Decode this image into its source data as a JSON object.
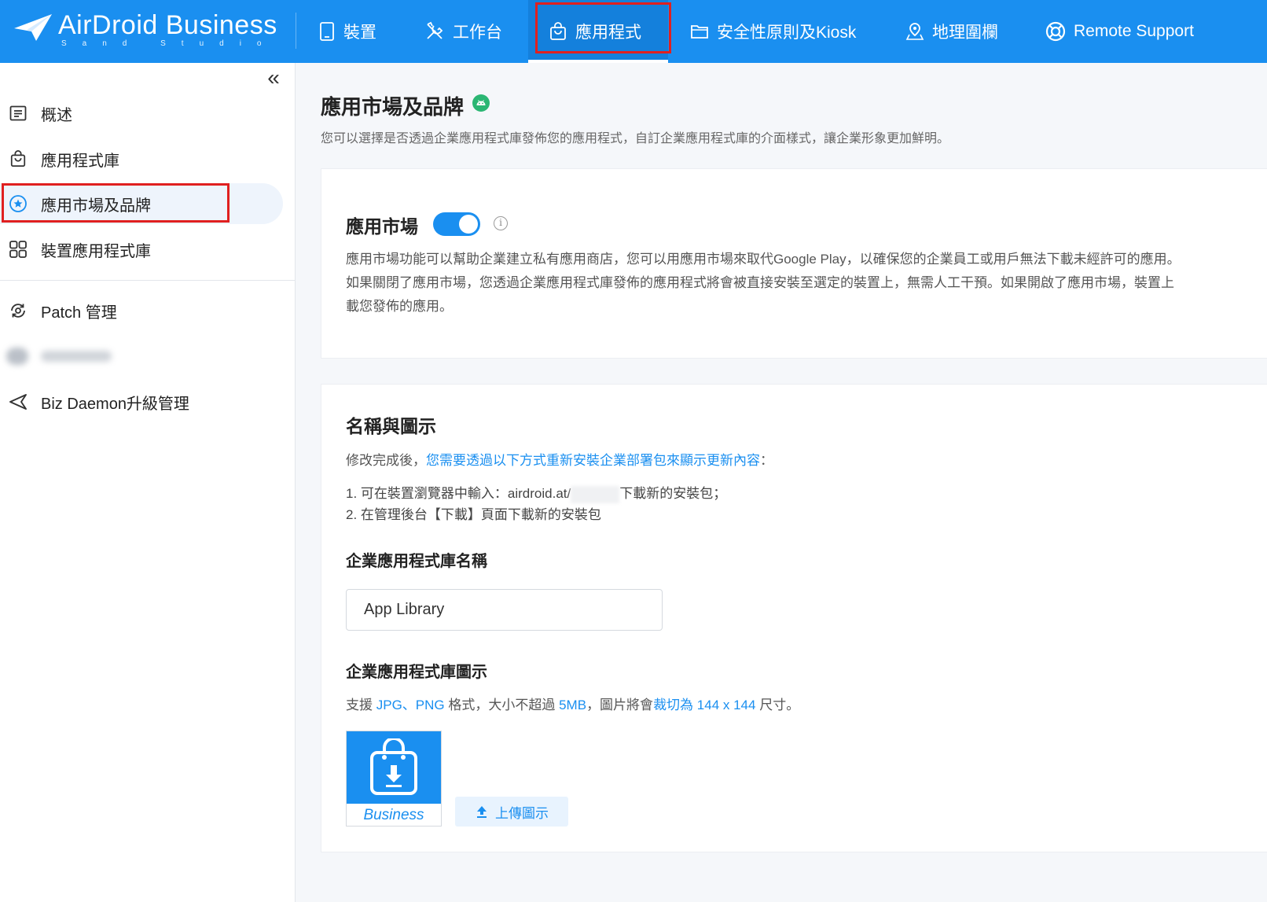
{
  "brand": {
    "name": "AirDroid Business",
    "sub": "Sand Studio"
  },
  "nav": {
    "devices": "裝置",
    "workbench": "工作台",
    "apps": "應用程式",
    "policy": "安全性原則及Kiosk",
    "geofence": "地理圍欄",
    "remote": "Remote Support"
  },
  "sidebar": {
    "collapse": "«",
    "items": [
      {
        "label": "概述"
      },
      {
        "label": "應用程式庫"
      },
      {
        "label": "應用市場及品牌"
      },
      {
        "label": "裝置應用程式庫"
      },
      {
        "label": "Patch 管理"
      },
      {
        "label": "Biz Daemon升級管理"
      }
    ]
  },
  "page": {
    "title": "應用市場及品牌",
    "desc": "您可以選擇是否透過企業應用程式庫發佈您的應用程式，自訂企業應用程式庫的介面樣式，讓企業形象更加鮮明。"
  },
  "market": {
    "title": "應用市場",
    "toggle_on": true,
    "info": "i",
    "lines": [
      "應用市場功能可以幫助企業建立私有應用商店，您可以用應用市場來取代Google Play，以確保您的企業員工或用戶無法下載未經許可的應用。",
      "如果關閉了應用市場，您透過企業應用程式庫發佈的應用程式將會被直接安裝至選定的裝置上，無需人工干預。如果開啟了應用市場，裝置上",
      "載您發佈的應用。"
    ]
  },
  "branding": {
    "title": "名稱與圖示",
    "hint_prefix": "修改完成後，",
    "hint_link": "您需要透過以下方式重新安裝企業部署包來顯示更新內容",
    "hint_suffix": "：",
    "step1_a": "1. 可在裝置瀏覽器中輸入：airdroid.at/",
    "step1_b": "下載新的安裝包；",
    "step2": "2. 在管理後台【下載】頁面下載新的安裝包",
    "name_label": "企業應用程式庫名稱",
    "name_value": "App Library",
    "icon_label": "企業應用程式庫圖示",
    "support": {
      "p1": "支援 ",
      "jpg": "JPG",
      "sep": "、",
      "png": "PNG",
      "p2": " 格式，大小不超過 ",
      "size": "5MB",
      "p3": "，圖片將會",
      "crop": "裁切為 144 x 144",
      "p4": " 尺寸。"
    },
    "icon_caption": "Business",
    "upload": "上傳圖示"
  },
  "colors": {
    "primary": "#1a8ff0",
    "highlight": "#e02020"
  }
}
